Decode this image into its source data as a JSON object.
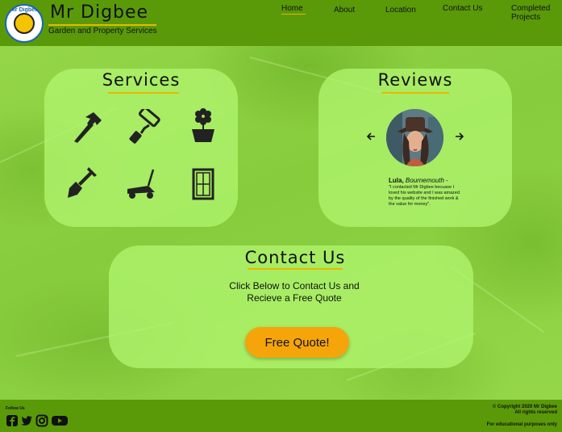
{
  "header": {
    "logo_text": "Mr Digbee",
    "brand": "Mr Digbee",
    "tagline": "Garden and Property Services",
    "nav": [
      {
        "label": "Home"
      },
      {
        "label": "About"
      },
      {
        "label": "Location"
      },
      {
        "label": "Contact Us"
      },
      {
        "label": "Completed Projects"
      }
    ]
  },
  "services": {
    "title": "Services",
    "icons": [
      "hammer-icon",
      "paint-roller-icon",
      "flower-pot-icon",
      "shovel-icon",
      "lawn-mower-icon",
      "window-icon"
    ]
  },
  "reviews": {
    "title": "Reviews",
    "reviewer_name": "Lula,",
    "reviewer_location": "Bournemouth",
    "dash": " -",
    "quote": "\"I contacted Mr Digbee becuase I loved his website and I was amazed by the quality of the finished work & the value for money\"."
  },
  "contact": {
    "title": "Contact Us",
    "subtitle": "Click Below to Contact Us and Recieve a Free Quote",
    "button": "Free Quote!"
  },
  "footer": {
    "follow_label": "Follow Us",
    "social": [
      "facebook-icon",
      "twitter-icon",
      "instagram-icon",
      "youtube-icon"
    ],
    "copyright_line1": "Copyright 2020 Mr Digbee",
    "copyright_line2": "All rights reserved",
    "educational": "For educational purposes only"
  },
  "colors": {
    "header_bg": "#5a9a09",
    "accent_underline": "#e9b800",
    "button_bg": "#f5a50a",
    "panel_bg": "#b4f57a"
  }
}
